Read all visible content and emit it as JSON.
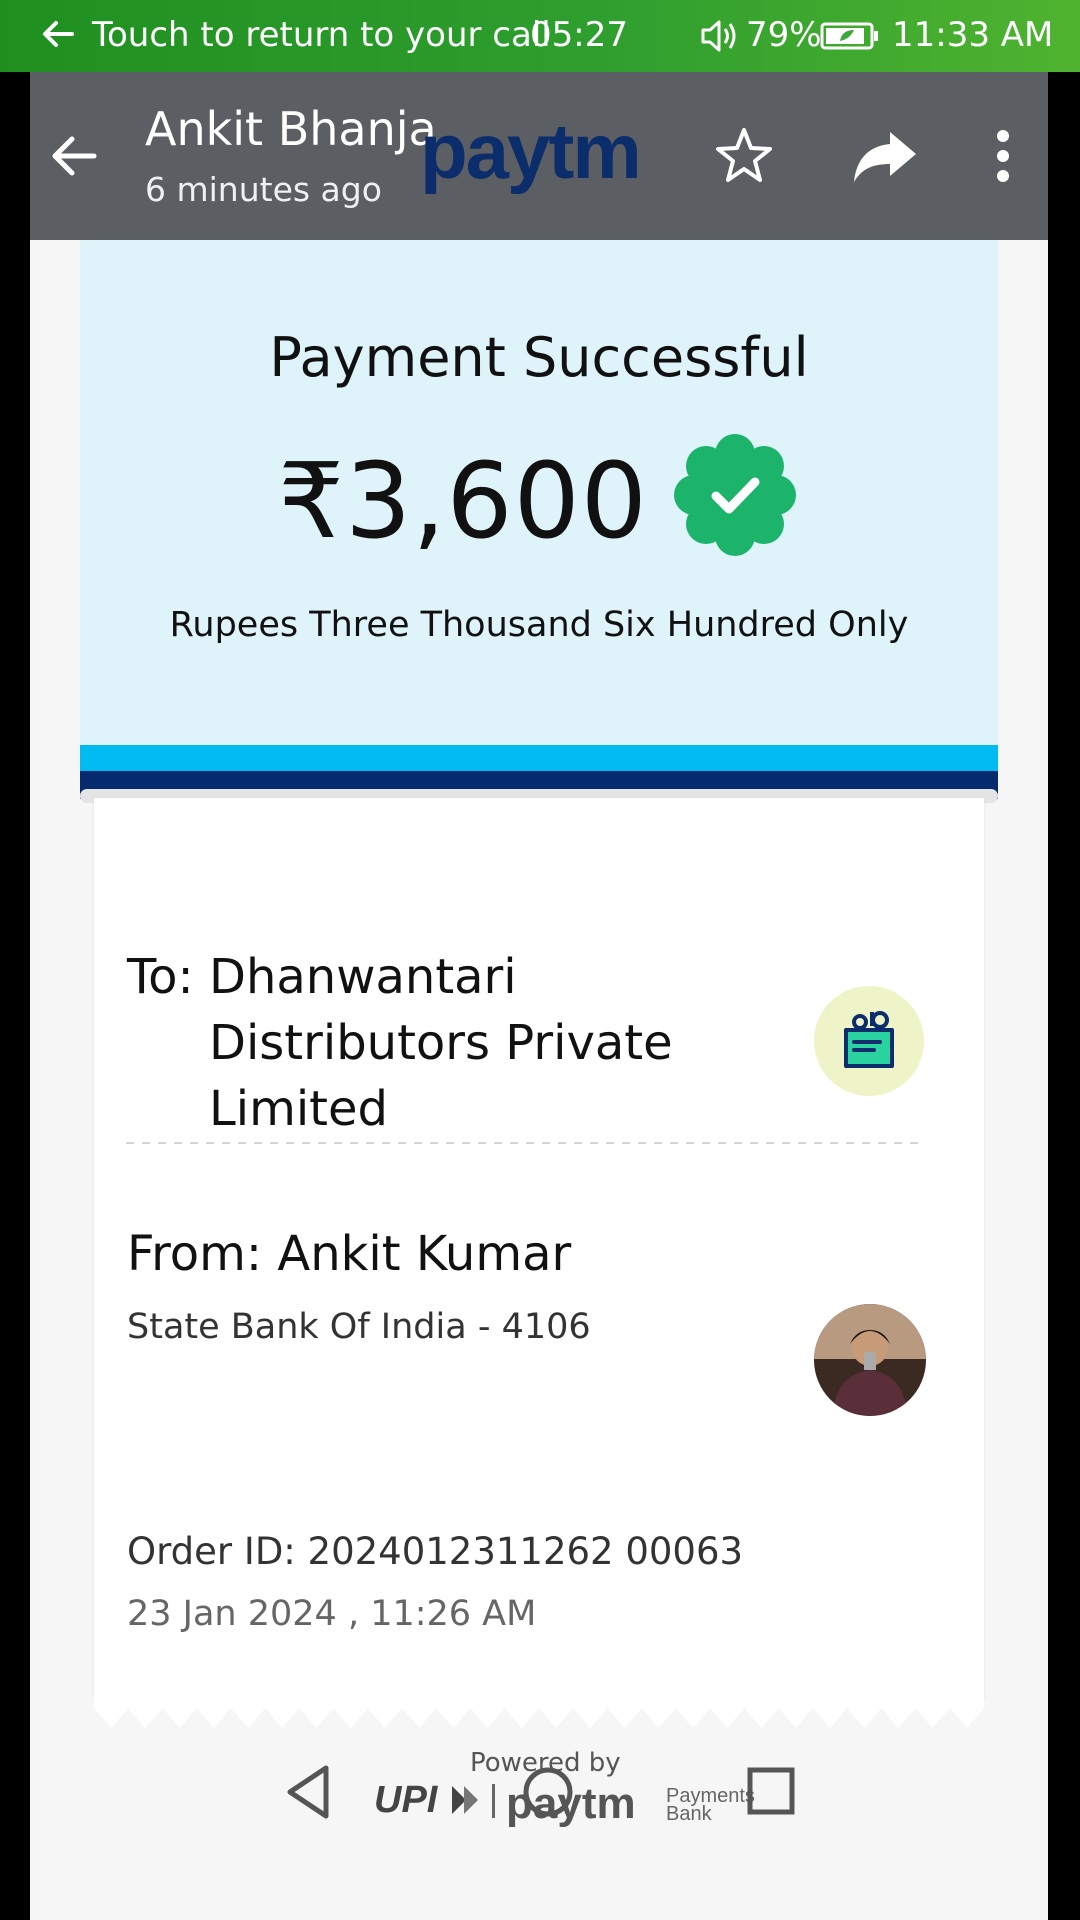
{
  "status_bar": {
    "call_text": "Touch to return to your call",
    "call_timer": "05:27",
    "battery": "79%",
    "time": "11:33 AM"
  },
  "header": {
    "sender": "Ankit Bhanja",
    "subtitle": "6 minutes ago",
    "logo_text": "paytm"
  },
  "payment": {
    "status": "Payment Successful",
    "amount": "₹3,600",
    "amount_words": "Rupees Three Thousand Six Hundred Only"
  },
  "receipt": {
    "to_label": "To:",
    "to_name": "Dhanwantari Distributors Private Limited",
    "from_label": "From:",
    "from_name": "Ankit Kumar",
    "bank": "State Bank Of India - 4106",
    "order_id_label": "Order ID:",
    "order_id": "2024012311262 00063",
    "datetime": "23 Jan 2024 , 11:26 AM"
  },
  "footer": {
    "powered_by": "Powered by",
    "upi_text": "UPI",
    "paytm_text": "paytm",
    "bank_line1": "Payments",
    "bank_line2": "Bank"
  },
  "colors": {
    "status_bar_green": "#2e9e2e",
    "toolbar_gray": "#5b5e63",
    "card_bg": "#dff3fb",
    "paytm_light_blue": "#00baf2",
    "paytm_dark_blue": "#062a6e",
    "success_green": "#1cb36b"
  }
}
